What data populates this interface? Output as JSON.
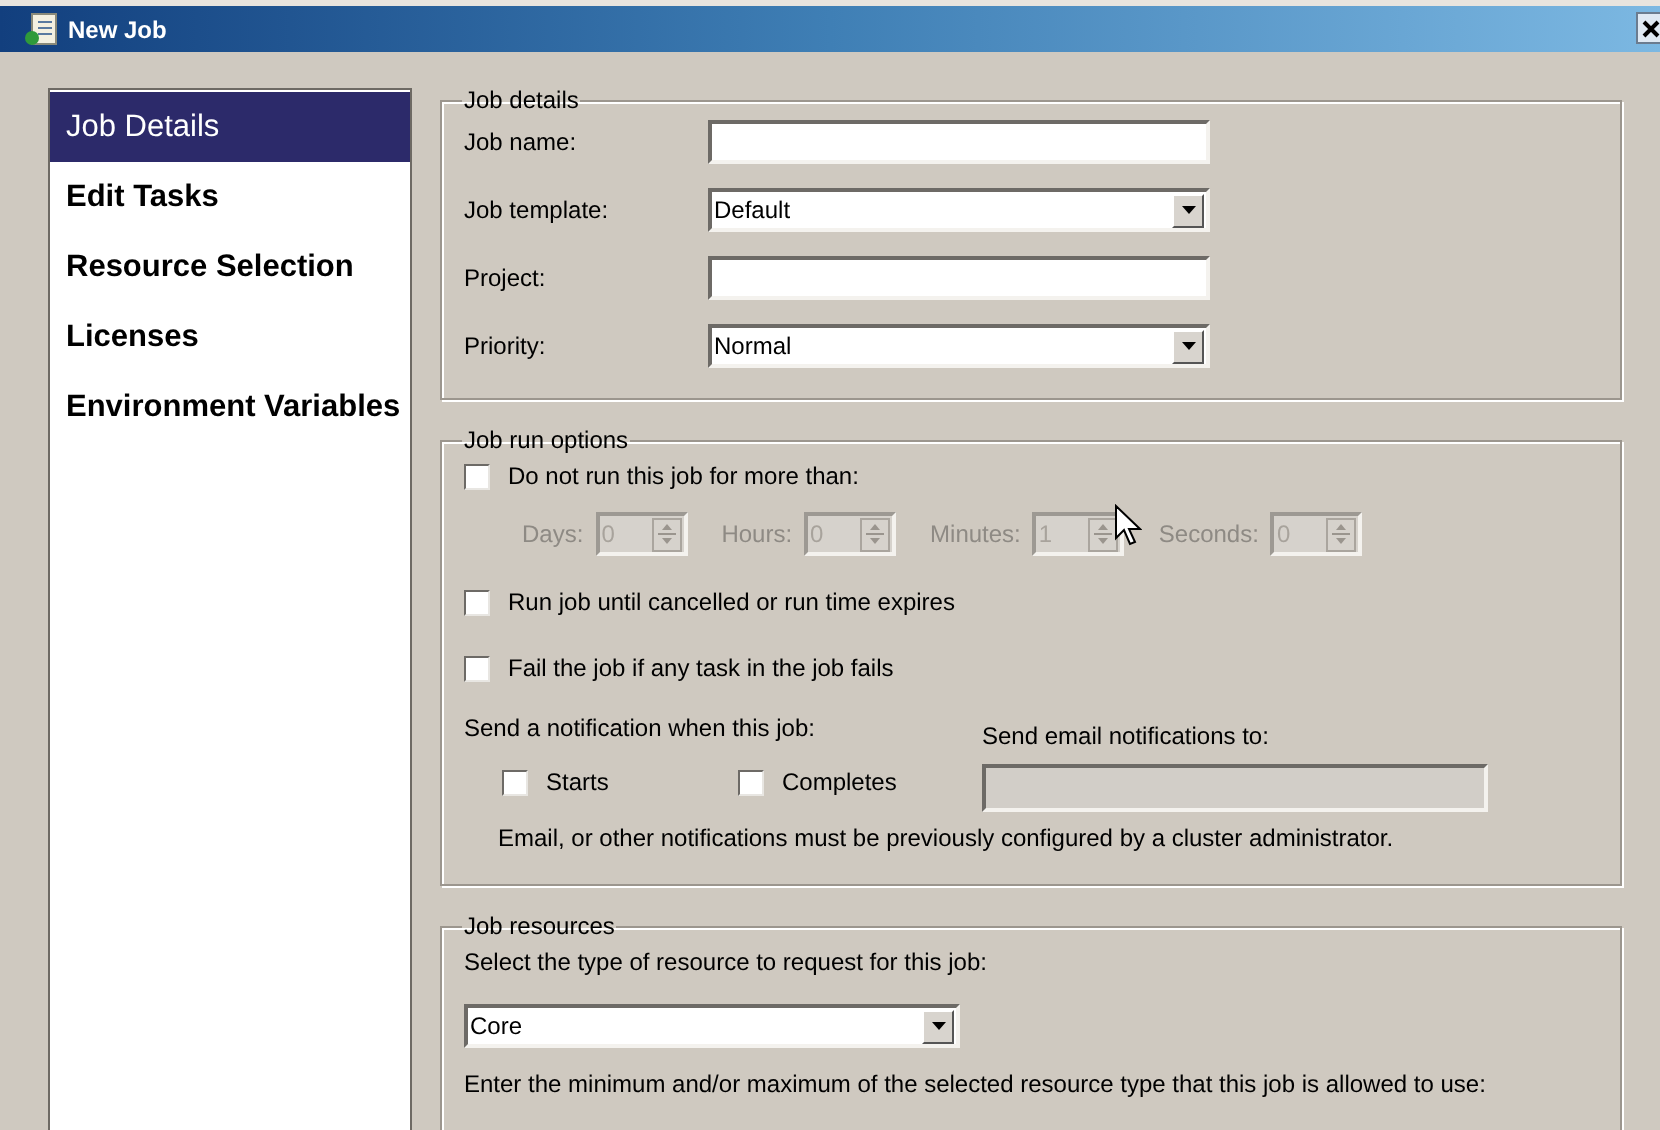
{
  "window": {
    "title": "New Job"
  },
  "sidebar": {
    "items": [
      {
        "label": "Job Details",
        "selected": true
      },
      {
        "label": "Edit Tasks",
        "selected": false
      },
      {
        "label": "Resource Selection",
        "selected": false
      },
      {
        "label": "Licenses",
        "selected": false
      },
      {
        "label": "Environment Variables",
        "selected": false
      }
    ]
  },
  "job_details": {
    "title": "Job details",
    "fields": [
      {
        "label": "Job name:",
        "kind": "text"
      },
      {
        "label": "Job template:",
        "kind": "dropdown",
        "value": "Default"
      },
      {
        "label": "Project:",
        "kind": "text"
      },
      {
        "label": "Priority:",
        "kind": "dropdown",
        "value": "Normal"
      }
    ]
  },
  "run_options": {
    "title": "Job run options",
    "limit": {
      "label": "Do not run this job for more than:",
      "checked": false
    },
    "durations": [
      {
        "label": "Days:",
        "value": "0",
        "disabled": true
      },
      {
        "label": "Hours:",
        "value": "0",
        "disabled": true
      },
      {
        "label": "Minutes:",
        "value": "1",
        "disabled": true
      },
      {
        "label": "Seconds:",
        "value": "0",
        "disabled": true
      }
    ],
    "until_cancelled": {
      "label": "Run job until cancelled or run time expires",
      "checked": false
    },
    "fail_on_task": {
      "label": "Fail the job if any task in the job fails",
      "checked": false
    },
    "notify_label": "Send a notification when this job:",
    "notify": [
      {
        "label": "Starts",
        "checked": false
      },
      {
        "label": "Completes",
        "checked": false
      }
    ],
    "email_label": "Send email notifications to:",
    "email": {
      "disabled": true
    },
    "note": "Email, or other notifications must be previously configured by a cluster administrator."
  },
  "resources": {
    "title": "Job resources",
    "prompt": "Select the type of resource to request for this job:",
    "type": {
      "value": "Core"
    },
    "hint": "Enter the minimum and/or maximum of the selected resource type that this job is allowed to use:"
  }
}
